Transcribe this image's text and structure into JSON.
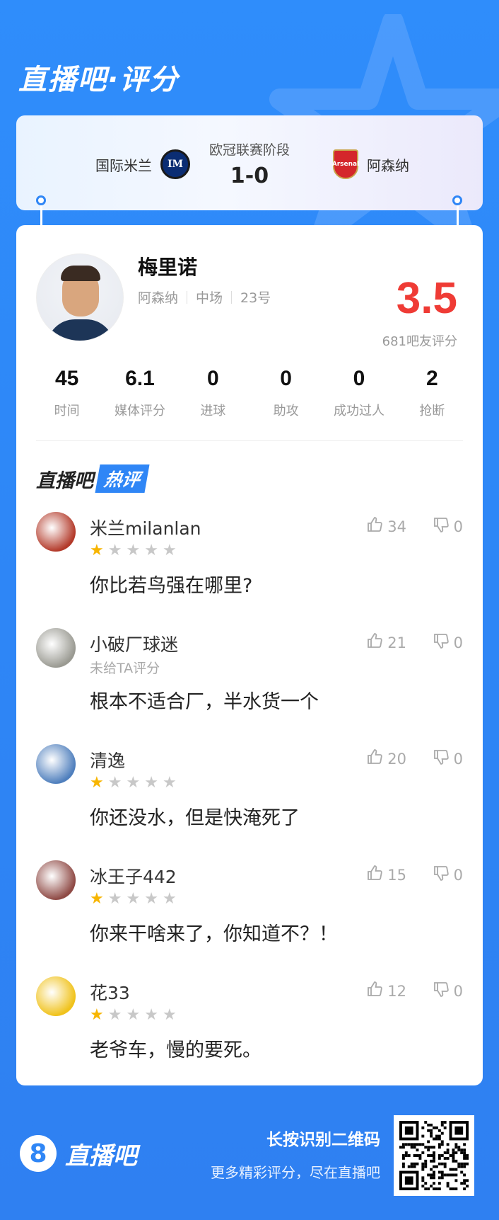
{
  "brand": {
    "title": "直播吧·评分"
  },
  "match": {
    "stage": "欧冠联赛阶段",
    "score": "1-0",
    "home_team": "国际米兰",
    "away_team": "阿森纳",
    "home_logo_text": "IM",
    "away_logo_text": "Arsenal"
  },
  "player": {
    "name": "梅里诺",
    "team": "阿森纳",
    "position": "中场",
    "number": "23号",
    "rating": "3.5",
    "rating_count": "681吧友评分"
  },
  "stats": [
    {
      "value": "45",
      "label": "时间"
    },
    {
      "value": "6.1",
      "label": "媒体评分"
    },
    {
      "value": "0",
      "label": "进球"
    },
    {
      "value": "0",
      "label": "助攻"
    },
    {
      "value": "0",
      "label": "成功过人"
    },
    {
      "value": "2",
      "label": "抢断"
    }
  ],
  "hot_comments_title": {
    "a": "直播吧",
    "b": "热评"
  },
  "comments": [
    {
      "user": "米兰milanlan",
      "stars": 1,
      "sub": "",
      "text": "你比若鸟强在哪里?",
      "likes": "34",
      "dislikes": "0",
      "avatar_color": "#b33a2a"
    },
    {
      "user": "小破厂球迷",
      "stars": 0,
      "sub": "未给TA评分",
      "text": "根本不适合厂，半水货一个",
      "likes": "21",
      "dislikes": "0",
      "avatar_color": "#9a9a92"
    },
    {
      "user": "清逸",
      "stars": 1,
      "sub": "",
      "text": "你还没水，但是快淹死了",
      "likes": "20",
      "dislikes": "0",
      "avatar_color": "#4f7fbd"
    },
    {
      "user": "冰王子442",
      "stars": 1,
      "sub": "",
      "text": "你来干啥来了，你知道不？！",
      "likes": "15",
      "dislikes": "0",
      "avatar_color": "#8f4a45"
    },
    {
      "user": "花33",
      "stars": 1,
      "sub": "",
      "text": "老爷车，慢的要死。",
      "likes": "12",
      "dislikes": "0",
      "avatar_color": "#f0c21b"
    }
  ],
  "footer": {
    "logo_mark": "8",
    "logo_text": "直播吧",
    "cta_title": "长按识别二维码",
    "cta_sub": "更多精彩评分，尽在直播吧"
  },
  "colors": {
    "accent": "#2f86f6",
    "rating": "#ef3b35",
    "star_on": "#f7b500"
  }
}
